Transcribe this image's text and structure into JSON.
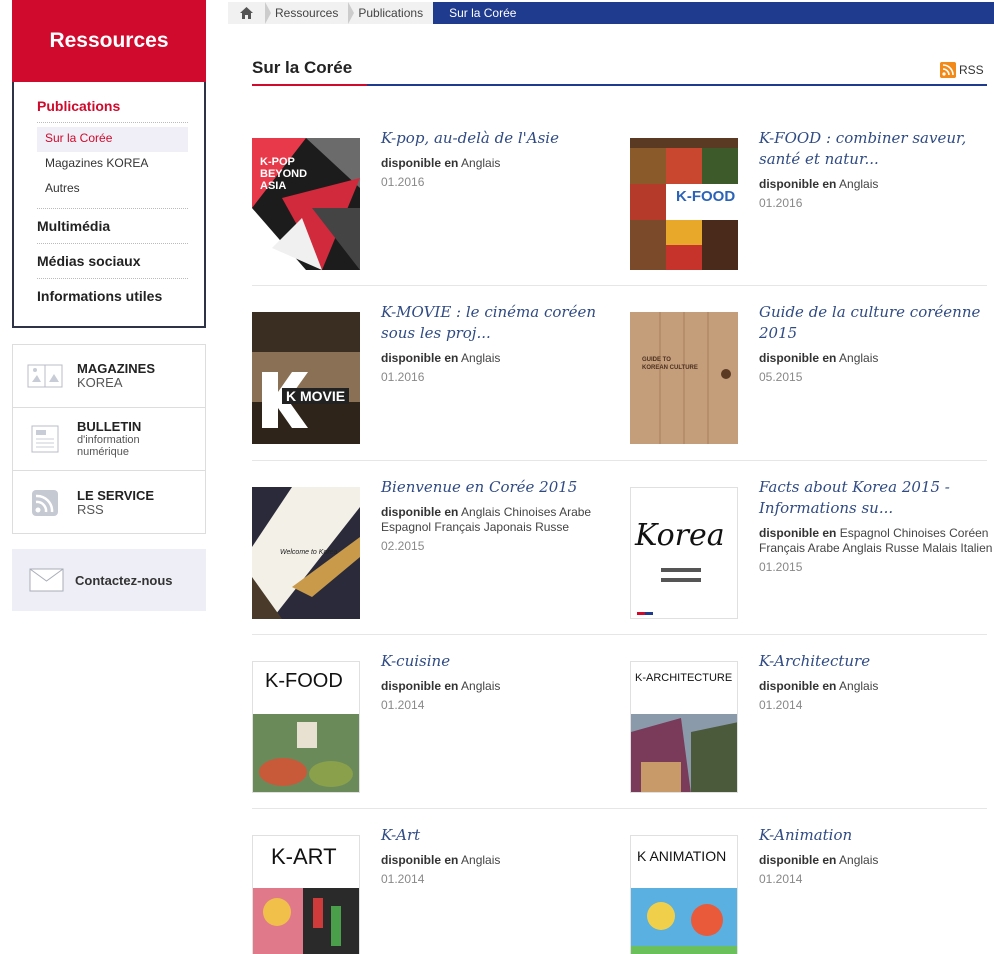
{
  "sidebar": {
    "header": "Ressources",
    "menu": {
      "publications": "Publications",
      "subitems": [
        "Sur la Corée",
        "Magazines KOREA",
        "Autres"
      ],
      "multimedia": "Multimédia",
      "social": "Médias sociaux",
      "useful": "Informations utiles"
    },
    "quick": [
      {
        "title": "MAGAZINES",
        "subtitle": "KOREA"
      },
      {
        "title": "BULLETIN",
        "subtitle": "d'information numérique"
      },
      {
        "title": "LE SERVICE",
        "subtitle": "RSS"
      }
    ],
    "contact": "Contactez-nous"
  },
  "breadcrumb": [
    "Ressources",
    "Publications",
    "Sur la Corée"
  ],
  "page": {
    "title": "Sur la Corée",
    "rss": "RSS",
    "available_label": "disponible",
    "available_in": "en"
  },
  "items": [
    {
      "title": "K-pop, au-delà de l'Asie",
      "languages": "Anglais",
      "date": "01.2016",
      "cover_text": "K-POP\nBEYOND\nASIA"
    },
    {
      "title": "K-FOOD : combiner saveur, santé et natur...",
      "languages": "Anglais",
      "date": "01.2016",
      "cover_text": "K-FOOD"
    },
    {
      "title": "K-MOVIE : le cinéma coréen sous les proj...",
      "languages": "Anglais",
      "date": "01.2016",
      "cover_text": "K MOVIE"
    },
    {
      "title": "Guide de la culture coréenne 2015",
      "languages": "Anglais",
      "date": "05.2015",
      "cover_text": "GUIDE TO\nKOREAN CULTURE"
    },
    {
      "title": "Bienvenue en Corée 2015",
      "languages": "Anglais  Chinoises  Arabe  Espagnol  Français  Japonais  Russe",
      "date": "02.2015",
      "cover_text": "Welcome to Korea"
    },
    {
      "title": "Facts about Korea 2015 - Informations su...",
      "languages": "Espagnol  Chinoises  Coréen  Français  Arabe  Anglais  Russe  Malais  Italien",
      "date": "01.2015",
      "cover_text": "Korea"
    },
    {
      "title": "K-cuisine",
      "languages": "Anglais",
      "date": "01.2014",
      "cover_text": "K-FOOD"
    },
    {
      "title": "K-Architecture",
      "languages": "Anglais",
      "date": "01.2014",
      "cover_text": "K-ARCHITECTURE"
    },
    {
      "title": "K-Art",
      "languages": "Anglais",
      "date": "01.2014",
      "cover_text": "K-ART"
    },
    {
      "title": "K-Animation",
      "languages": "Anglais",
      "date": "01.2014",
      "cover_text": "K ANIMATION"
    }
  ]
}
